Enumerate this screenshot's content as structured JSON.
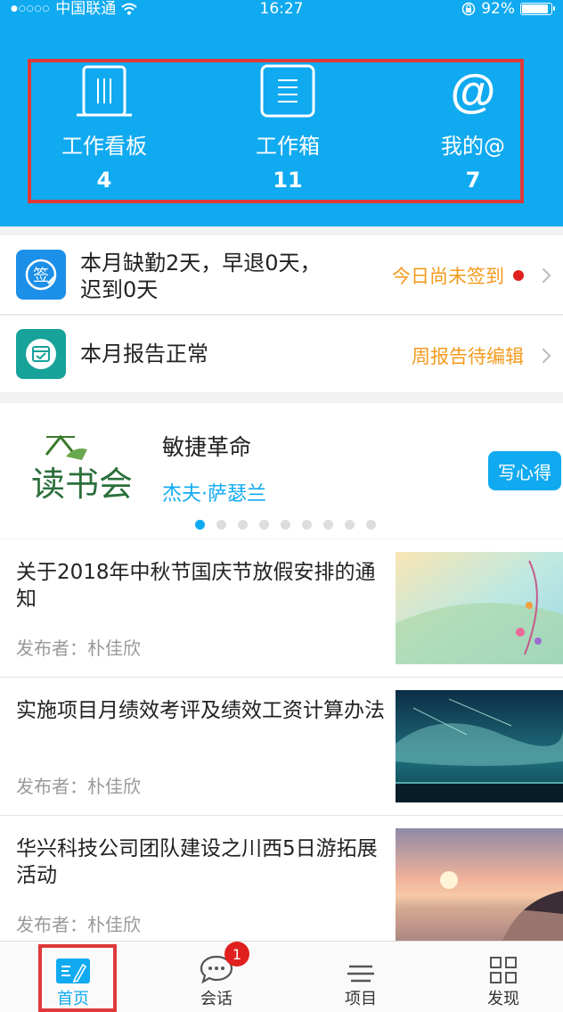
{
  "status_bar": {
    "carrier": "中国联通",
    "time": "16:27",
    "battery": "92%",
    "battery_level": 0.92
  },
  "shortcuts": [
    {
      "label": "工作看板",
      "count": "4",
      "icon": "board-icon"
    },
    {
      "label": "工作箱",
      "count": "11",
      "icon": "inbox-icon"
    },
    {
      "label": "我的@",
      "count": "7",
      "icon": "at-icon"
    }
  ],
  "attendance": {
    "line1": "本月缺勤2天，早退0天，",
    "line2": "迟到0天",
    "status": "今日尚未签到"
  },
  "report": {
    "text": "本月报告正常",
    "status": "周报告待编辑"
  },
  "book_club": {
    "logo_text": "读书会",
    "title": "敏捷革命",
    "author": "杰夫·萨瑟兰",
    "button": "写心得",
    "page_count": 9,
    "active_page": 1
  },
  "news": [
    {
      "title": "关于2018年中秋节国庆节放假安排的通知",
      "publisher": "发布者：朴佳欣"
    },
    {
      "title": "实施项目月绩效考评及绩效工资计算办法",
      "publisher": "发布者：朴佳欣"
    },
    {
      "title": "华兴科技公司团队建设之川西5日游拓展活动",
      "publisher": "发布者：朴佳欣"
    }
  ],
  "tabs": [
    {
      "label": "首页",
      "icon": "home-icon"
    },
    {
      "label": "会话",
      "icon": "chat-icon",
      "badge": "1"
    },
    {
      "label": "项目",
      "icon": "menu-icon"
    },
    {
      "label": "发现",
      "icon": "grid-icon"
    }
  ],
  "colors": {
    "primary": "#10aaf0",
    "accent": "#f39a1d",
    "alert": "#e0201f",
    "highlight": "#e0393a"
  }
}
